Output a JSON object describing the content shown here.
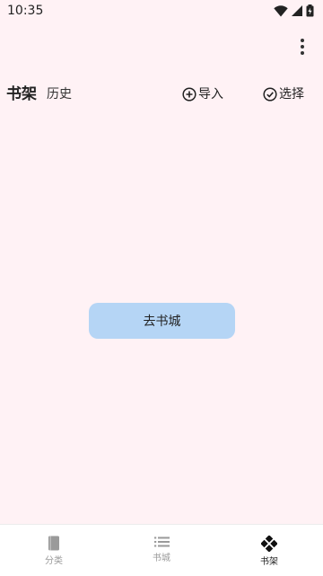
{
  "status_bar": {
    "time": "10:35"
  },
  "header": {
    "tabs": [
      {
        "label": "书架"
      },
      {
        "label": "历史"
      }
    ],
    "actions": {
      "import_label": "导入",
      "select_label": "选择"
    }
  },
  "main": {
    "goto_button_label": "去书城"
  },
  "bottom_nav": {
    "items": [
      {
        "label": "分类",
        "icon": "book-icon"
      },
      {
        "label": "书城",
        "icon": "list-icon"
      },
      {
        "label": "书架",
        "icon": "gamepad-icon"
      }
    ],
    "active_index": 2
  },
  "colors": {
    "background": "#fff2f5",
    "button": "#b5d5f5",
    "inactive_nav": "#9a9a9a"
  }
}
